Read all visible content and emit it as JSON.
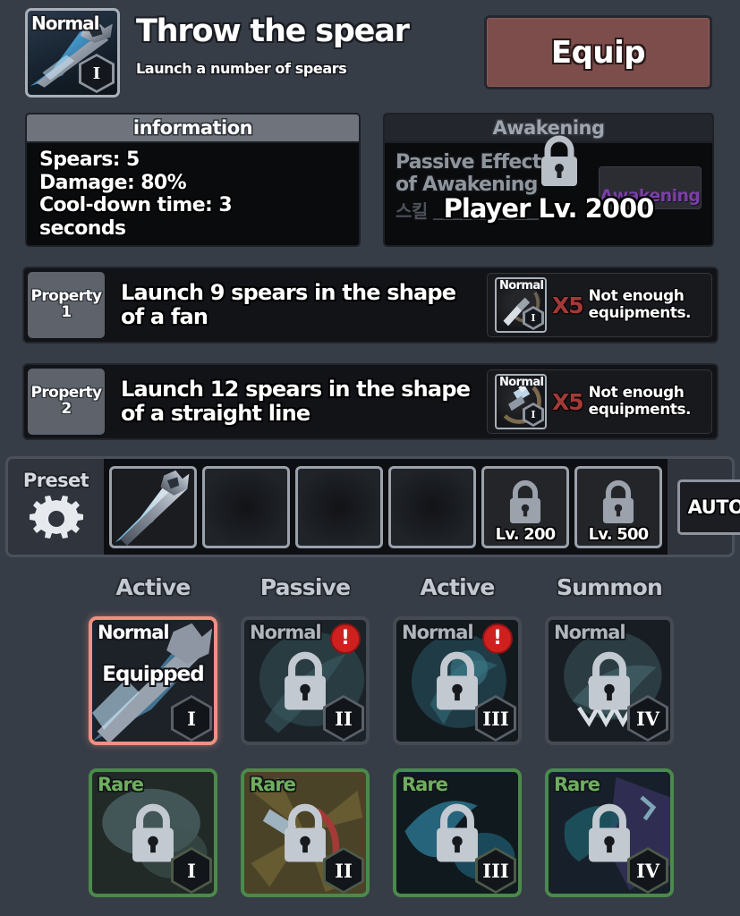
{
  "header": {
    "icon": {
      "name": "skill-icon-spear",
      "rarity": "Normal",
      "level_numeral": "I"
    },
    "title": "Throw the spear",
    "subtitle": "Launch a number of spears",
    "equip_label": "Equip"
  },
  "information": {
    "title": "information",
    "lines": [
      "Spears: 5",
      "Damage: 80%",
      "Cool-down time: 3",
      "seconds"
    ]
  },
  "awakening": {
    "title": "Awakening",
    "passive_line_1": "Passive Effect",
    "passive_line_2": "of Awakening",
    "passive_line_kr": "스킬 \u0000\u0000\u0000\u0000\u0000\u0000\u0000",
    "button_label": "Awakening",
    "requirement": "Player Lv. 2000",
    "lock_icon": "lock-icon"
  },
  "properties": [
    {
      "badge_label": "Property",
      "badge_number": "1",
      "description": "Launch 9 spears in the shape of a fan",
      "material": {
        "rarity": "Normal",
        "numeral": "I",
        "icon": "spear-head-material-icon"
      },
      "count": "X5",
      "message": "Not enough equipments."
    },
    {
      "badge_label": "Property",
      "badge_number": "2",
      "description": "Launch 12 spears in the shape of a straight line",
      "material": {
        "rarity": "Normal",
        "numeral": "I",
        "icon": "spear-bundle-material-icon"
      },
      "count": "X5",
      "message": "Not enough equipments."
    }
  ],
  "preset": {
    "label": "Preset",
    "gear_icon": "gear-icon",
    "slots": [
      {
        "state": "filled",
        "icon": "spear-skill-icon",
        "lock_label": ""
      },
      {
        "state": "empty",
        "icon": "",
        "lock_label": ""
      },
      {
        "state": "empty",
        "icon": "",
        "lock_label": ""
      },
      {
        "state": "empty",
        "icon": "",
        "lock_label": ""
      },
      {
        "state": "locked",
        "icon": "lock-icon",
        "lock_label": "Lv. 200"
      },
      {
        "state": "locked",
        "icon": "lock-icon",
        "lock_label": "Lv. 500"
      }
    ],
    "auto_label": "AUTO"
  },
  "categories": [
    "Active",
    "Passive",
    "Active",
    "Summon"
  ],
  "skill_grid": {
    "rows": [
      {
        "rarity_color": "#aeb4bc",
        "cards": [
          {
            "rarity": "Normal",
            "numeral": "I",
            "status": "Equipped",
            "locked": false,
            "alert": false,
            "equipped": true,
            "art": "spear-art"
          },
          {
            "rarity": "Normal",
            "numeral": "II",
            "status": "",
            "locked": true,
            "alert": true,
            "equipped": false,
            "art": "dark-teal-art"
          },
          {
            "rarity": "Normal",
            "numeral": "III",
            "status": "",
            "locked": true,
            "alert": true,
            "equipped": false,
            "art": "teal-swirl-art"
          },
          {
            "rarity": "Normal",
            "numeral": "IV",
            "status": "",
            "locked": true,
            "alert": false,
            "equipped": false,
            "art": "beast-art"
          }
        ]
      },
      {
        "rarity_color": "#6fae5f",
        "cards": [
          {
            "rarity": "Rare",
            "numeral": "I",
            "status": "",
            "locked": true,
            "alert": false,
            "equipped": false,
            "art": "rare-mist-art"
          },
          {
            "rarity": "Rare",
            "numeral": "II",
            "status": "",
            "locked": true,
            "alert": false,
            "equipped": false,
            "art": "rare-gold-art"
          },
          {
            "rarity": "Rare",
            "numeral": "III",
            "status": "",
            "locked": true,
            "alert": false,
            "equipped": false,
            "art": "rare-blue-art"
          },
          {
            "rarity": "Rare",
            "numeral": "IV",
            "status": "",
            "locked": true,
            "alert": false,
            "equipped": false,
            "art": "rare-purple-art"
          }
        ]
      }
    ]
  },
  "colors": {
    "background": "#373d47",
    "equip_button": "#7c4d4b",
    "awakening_text": "#7b3fa8",
    "count_red": "#a33a38",
    "equipped_border": "#f09080",
    "rare_border": "#4a8a4a",
    "alert_red": "#cf2020"
  }
}
